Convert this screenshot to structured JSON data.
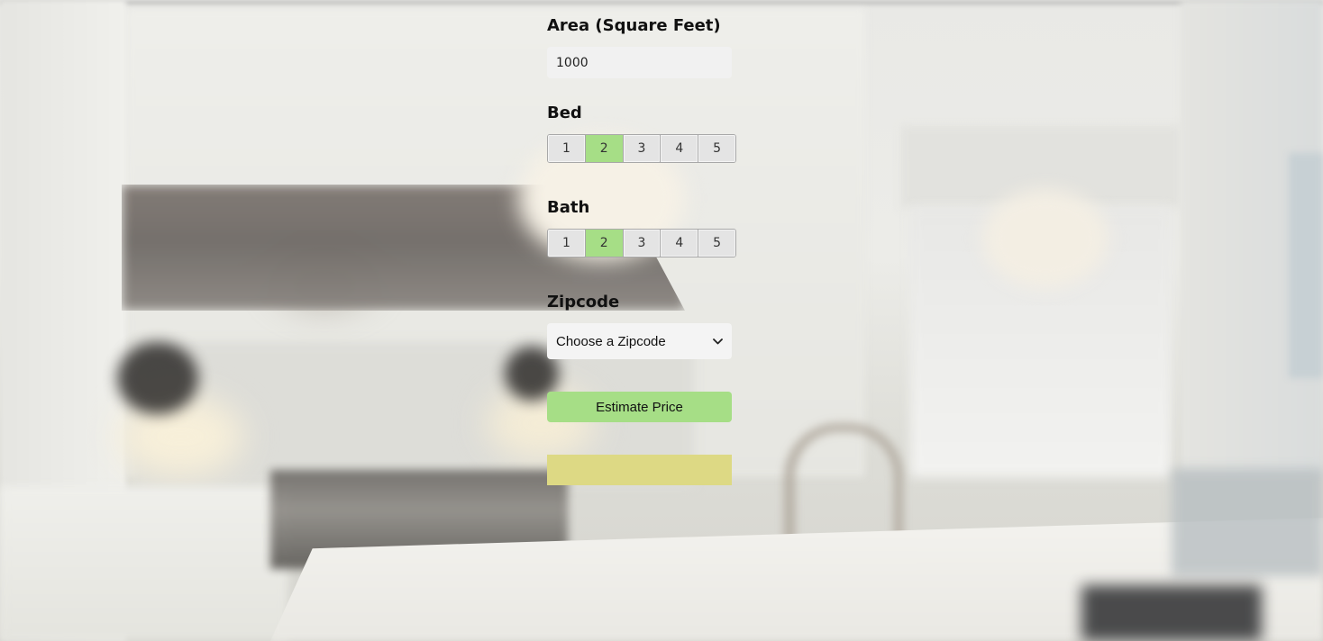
{
  "area": {
    "label": "Area (Square Feet)",
    "value": "1000"
  },
  "bed": {
    "label": "Bed",
    "options": [
      "1",
      "2",
      "3",
      "4",
      "5"
    ],
    "selected": "2"
  },
  "bath": {
    "label": "Bath",
    "options": [
      "1",
      "2",
      "3",
      "4",
      "5"
    ],
    "selected": "2"
  },
  "zipcode": {
    "label": "Zipcode",
    "selected_text": "Choose a Zipcode",
    "icon": "chevron-down-icon"
  },
  "estimate_button": {
    "label": "Estimate Price"
  },
  "result": {
    "text": ""
  },
  "colors": {
    "accent_green": "#a6de86",
    "result_yellow": "#ddd984",
    "input_bg": "#f1f1f1"
  }
}
